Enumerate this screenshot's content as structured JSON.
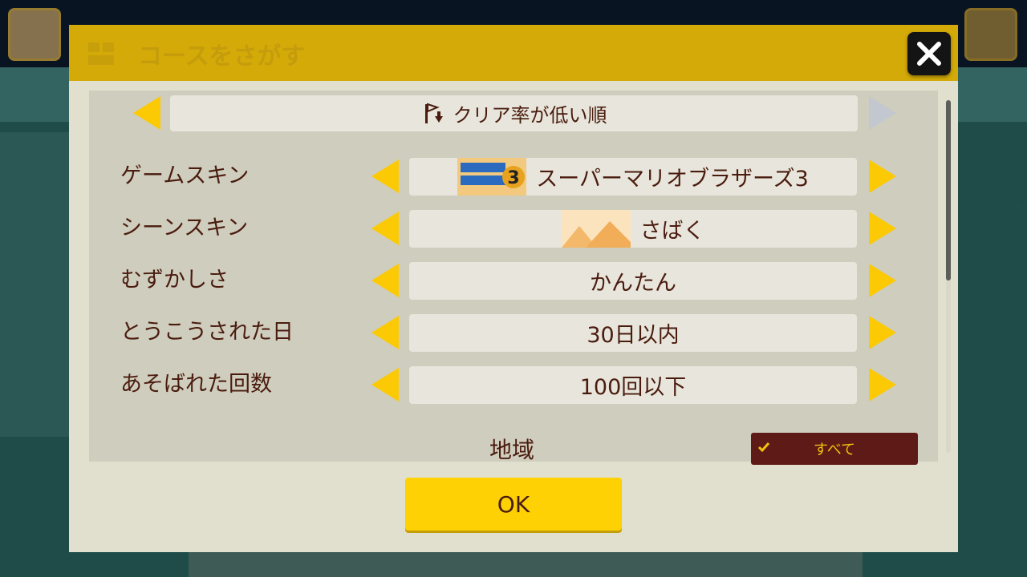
{
  "dialog": {
    "title": "コースをさがす",
    "close_icon": "close-icon",
    "sort": {
      "label": "クリア率が低い順",
      "icon": "flag-sort-icon"
    },
    "rows": [
      {
        "label": "ゲームスキン",
        "value": "スーパーマリオブラザーズ3",
        "thumb": "smb3-logo-icon"
      },
      {
        "label": "シーンスキン",
        "value": "さばく",
        "thumb": "desert-icon"
      },
      {
        "label": "むずかしさ",
        "value": "かんたん"
      },
      {
        "label": "とうこうされた日",
        "value": "30日以内"
      },
      {
        "label": "あそばれた回数",
        "value": "100回以下"
      }
    ],
    "region": {
      "label": "地域",
      "option": "すべて"
    },
    "ok_label": "OK"
  },
  "colors": {
    "header": "#d4aa08",
    "arrow": "#fcc905",
    "text": "#4a1c0f",
    "ok": "#fdd104",
    "region_bg": "#5e1a16"
  }
}
